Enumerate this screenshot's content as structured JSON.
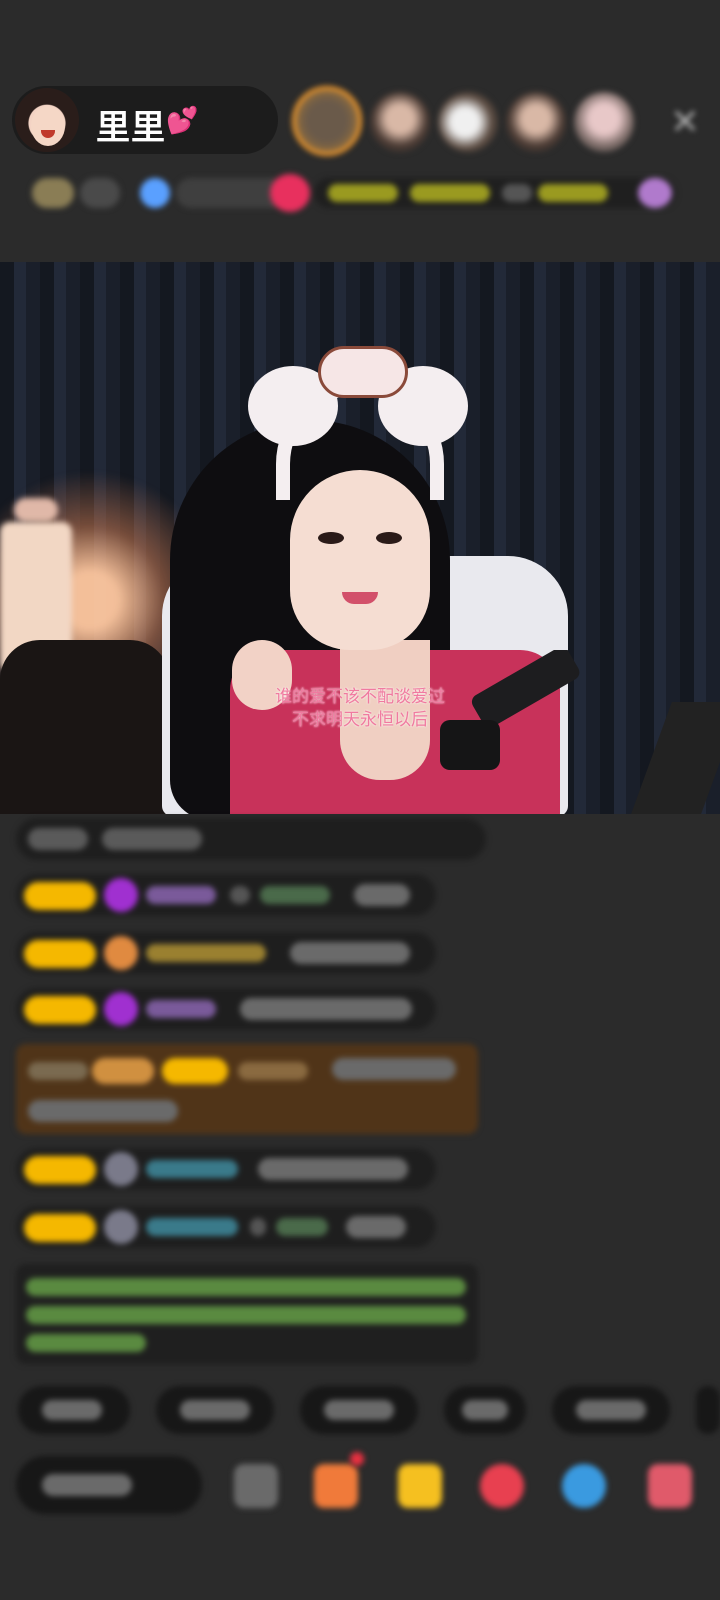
{
  "host": {
    "name": "里里",
    "emoji": "💕"
  },
  "icons": {
    "close": "×"
  },
  "stream": {
    "lyrics_line_1": "谁的爱不该不配谈爱过",
    "lyrics_line_2": "不求明天永恒以后"
  },
  "colors": {
    "badge": "#f5b800",
    "lyrics": "#f07aa0",
    "background": "#2b2b2b"
  }
}
